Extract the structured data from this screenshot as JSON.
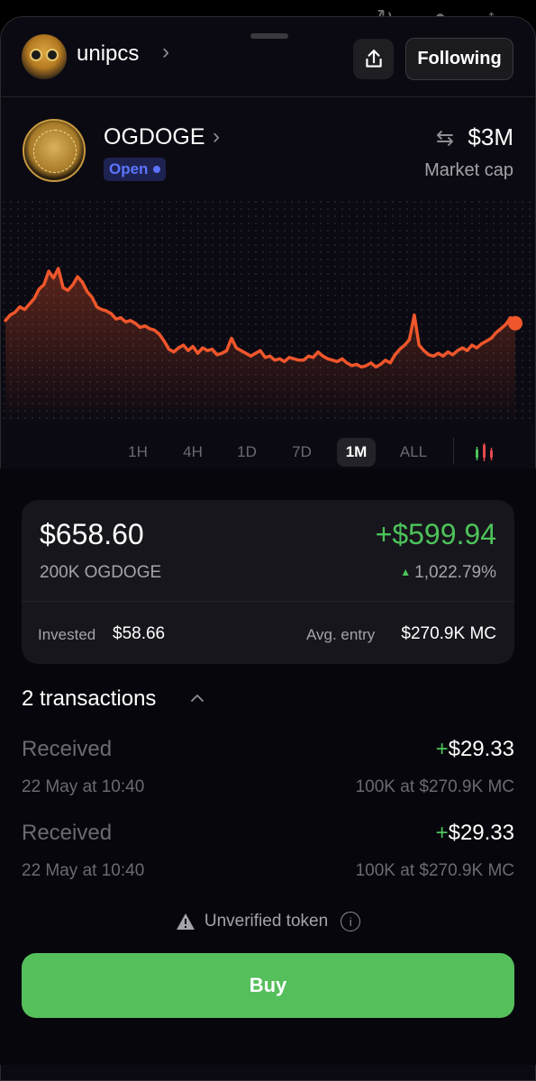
{
  "header": {
    "username": "unipcs",
    "follow_label": "Following"
  },
  "token": {
    "name": "OGDOGE",
    "status": "Open",
    "market_cap": "$3M",
    "market_cap_label": "Market cap"
  },
  "chart": {
    "line_color": "#f0562b",
    "ranges": [
      "1H",
      "4H",
      "1D",
      "7D",
      "1M",
      "ALL"
    ],
    "active_range": "1M"
  },
  "chart_data": {
    "type": "line",
    "title": "",
    "xlabel": "",
    "ylabel": "",
    "series": [
      {
        "values": [
          0.62,
          0.66,
          0.68,
          0.72,
          0.7,
          0.74,
          0.78,
          0.85,
          0.88,
          0.98,
          0.93,
          1.0,
          0.86,
          0.84,
          0.88,
          0.94,
          0.9,
          0.83,
          0.79,
          0.72,
          0.7,
          0.69,
          0.67,
          0.63,
          0.64,
          0.61,
          0.62,
          0.6,
          0.57,
          0.58,
          0.56,
          0.55,
          0.52,
          0.47,
          0.41,
          0.39,
          0.42,
          0.44,
          0.4,
          0.43,
          0.38,
          0.42,
          0.4,
          0.41,
          0.37,
          0.38,
          0.4,
          0.49,
          0.42,
          0.4,
          0.38,
          0.36,
          0.38,
          0.4,
          0.35,
          0.36,
          0.33,
          0.34,
          0.32,
          0.35,
          0.34,
          0.33,
          0.33,
          0.36,
          0.35,
          0.39,
          0.36,
          0.34,
          0.33,
          0.32,
          0.34,
          0.31,
          0.29,
          0.3,
          0.28,
          0.29,
          0.31,
          0.28,
          0.3,
          0.33,
          0.31,
          0.37,
          0.41,
          0.44,
          0.48,
          0.66,
          0.44,
          0.4,
          0.37,
          0.36,
          0.38,
          0.36,
          0.39,
          0.37,
          0.4,
          0.42,
          0.4,
          0.44,
          0.42,
          0.45,
          0.47,
          0.49,
          0.53,
          0.56,
          0.59,
          0.64,
          0.6
        ]
      }
    ],
    "grid": false,
    "legend": "none"
  },
  "position": {
    "value": "$658.60",
    "gain": "+$599.94",
    "amount": "200K OGDOGE",
    "gain_pct": "1,022.79%",
    "invested_label": "Invested",
    "invested_value": "$58.66",
    "avg_entry_label": "Avg. entry",
    "avg_entry_value": "$270.9K MC"
  },
  "transactions": {
    "title": "2 transactions",
    "items": [
      {
        "label": "Received",
        "sign": "+",
        "amount": "$29.33",
        "date": "22 May at 10:40",
        "detail": "100K at $270.9K MC"
      },
      {
        "label": "Received",
        "sign": "+",
        "amount": "$29.33",
        "date": "22 May at 10:40",
        "detail": "100K at $270.9K MC"
      }
    ]
  },
  "warning": {
    "text": "Unverified token"
  },
  "buy": {
    "label": "Buy"
  },
  "colors": {
    "accent_green": "#4cc35a",
    "buy_green": "#55bf5c",
    "open_blue": "#5b74ff",
    "chart_orange": "#f0562b"
  }
}
